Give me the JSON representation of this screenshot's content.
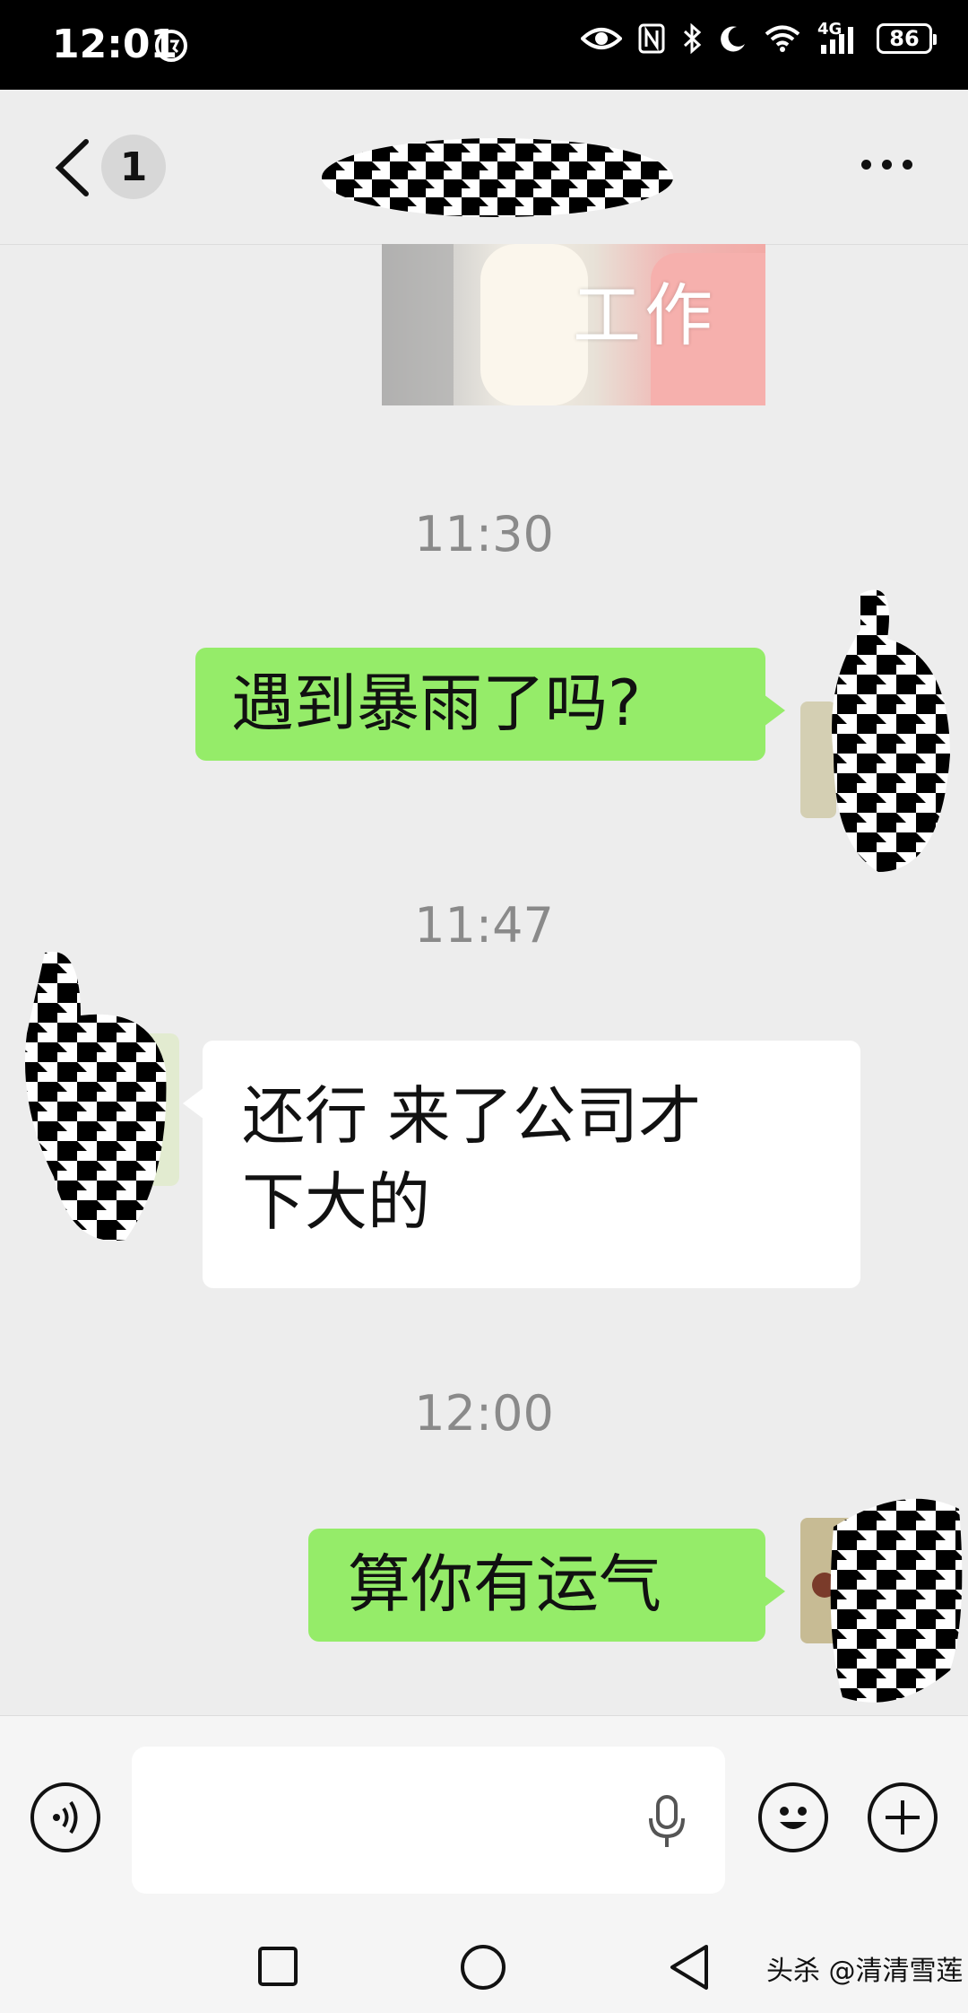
{
  "status_bar": {
    "time": "12:01",
    "battery": "86",
    "network": "4G",
    "icons": [
      "eye-icon",
      "nfc-icon",
      "bluetooth-icon",
      "moon-icon",
      "wifi-icon",
      "signal-icon"
    ]
  },
  "header": {
    "unread_count": "1",
    "contact_name_redacted": true
  },
  "chat": {
    "photo_caption": "工作",
    "messages": [
      {
        "time": "11:30",
        "sender": "me",
        "text": "遇到暴雨了吗?"
      },
      {
        "time": "11:47",
        "sender": "contact",
        "lines": [
          "还行 来了公司才",
          "下大的"
        ]
      },
      {
        "time": "12:00",
        "sender": "me",
        "text": "算你有运气"
      }
    ]
  },
  "input_bar": {
    "placeholder": ""
  },
  "watermark": "头杀 @清清雪莲",
  "colors": {
    "outgoing_bubble": "#95ec69",
    "incoming_bubble": "#ffffff",
    "background": "#ededed",
    "status_bar": "#000000"
  }
}
